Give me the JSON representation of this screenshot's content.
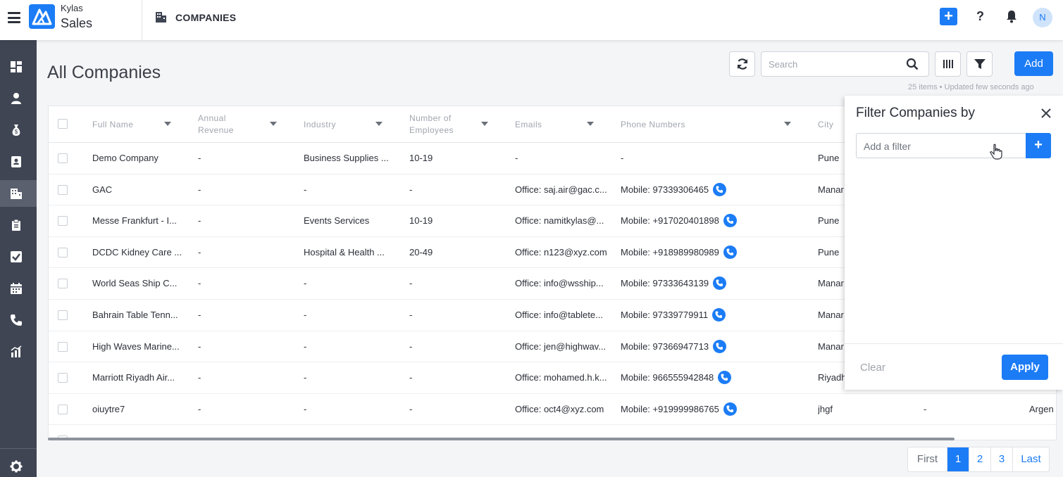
{
  "app": {
    "brand_top": "Kylas",
    "brand_bottom": "Sales",
    "module_title": "COMPANIES",
    "avatar_initial": "N",
    "accent": "#1c7cf5"
  },
  "header": {
    "quick_add": "+",
    "help": "?"
  },
  "sidebar": {
    "items": [
      {
        "icon": "dashboard-icon"
      },
      {
        "icon": "contacts-icon"
      },
      {
        "icon": "money-bag-icon"
      },
      {
        "icon": "contact-card-icon"
      },
      {
        "icon": "companies-icon",
        "active": true
      },
      {
        "icon": "clipboard-icon"
      },
      {
        "icon": "task-check-icon"
      },
      {
        "icon": "calendar-icon"
      },
      {
        "icon": "phone-icon"
      },
      {
        "icon": "reports-icon"
      }
    ],
    "settings_icon": "gear-icon"
  },
  "main": {
    "title": "All Companies",
    "search_placeholder": "Search",
    "add_label": "Add",
    "meta": "25 items • Updated few seconds ago"
  },
  "table": {
    "columns": [
      "Full Name",
      "Annual Revenue",
      "Industry",
      "Number of Employees",
      "Emails",
      "Phone Numbers",
      "City"
    ],
    "rows": [
      {
        "name": "Demo Company",
        "revenue": "-",
        "industry": "Business Supplies ...",
        "employees": "10-19",
        "email": "-",
        "phone": "-",
        "call": false,
        "city": "Pune"
      },
      {
        "name": "GAC",
        "revenue": "-",
        "industry": "-",
        "employees": "-",
        "email": "Office: saj.air@gac.c...",
        "phone": "Mobile: 97339306465",
        "call": true,
        "city": "Manar"
      },
      {
        "name": "Messe Frankfurt - I...",
        "revenue": "-",
        "industry": "Events Services",
        "employees": "10-19",
        "email": "Office: namitkylas@...",
        "phone": "Mobile: +917020401898",
        "call": true,
        "city": "Pune"
      },
      {
        "name": "DCDC Kidney Care ...",
        "revenue": "-",
        "industry": "Hospital & Health ...",
        "employees": "20-49",
        "email": "Office: n123@xyz.com",
        "phone": "Mobile: +918989980989",
        "call": true,
        "city": "Pune"
      },
      {
        "name": "World Seas Ship C...",
        "revenue": "-",
        "industry": "-",
        "employees": "-",
        "email": "Office: info@wsship...",
        "phone": "Mobile: 97333643139",
        "call": true,
        "city": "Manar"
      },
      {
        "name": "Bahrain Table Tenn...",
        "revenue": "-",
        "industry": "-",
        "employees": "-",
        "email": "Office: info@tablete...",
        "phone": "Mobile: 97339779911",
        "call": true,
        "city": "Manar"
      },
      {
        "name": "High Waves Marine...",
        "revenue": "-",
        "industry": "-",
        "employees": "-",
        "email": "Office: jen@highwav...",
        "phone": "Mobile: 97366947713",
        "call": true,
        "city": "Manar"
      },
      {
        "name": "Marriott Riyadh Air...",
        "revenue": "-",
        "industry": "-",
        "employees": "-",
        "email": "Office: mohamed.h.k...",
        "phone": "Mobile: 966555942848",
        "call": true,
        "city": "Riyadh"
      },
      {
        "name": "oiuytre7",
        "revenue": "-",
        "industry": "-",
        "employees": "-",
        "email": "Office: oct4@xyz.com",
        "phone": "Mobile: +919999986765",
        "call": true,
        "city": "jhgf",
        "extra1": "-",
        "extra2": "Argen"
      }
    ]
  },
  "pagination": {
    "first": "First",
    "pages": [
      "1",
      "2",
      "3"
    ],
    "current": "1",
    "last": "Last"
  },
  "filter": {
    "title": "Filter Companies by",
    "placeholder": "Add a filter",
    "plus": "+",
    "clear": "Clear",
    "apply": "Apply"
  }
}
